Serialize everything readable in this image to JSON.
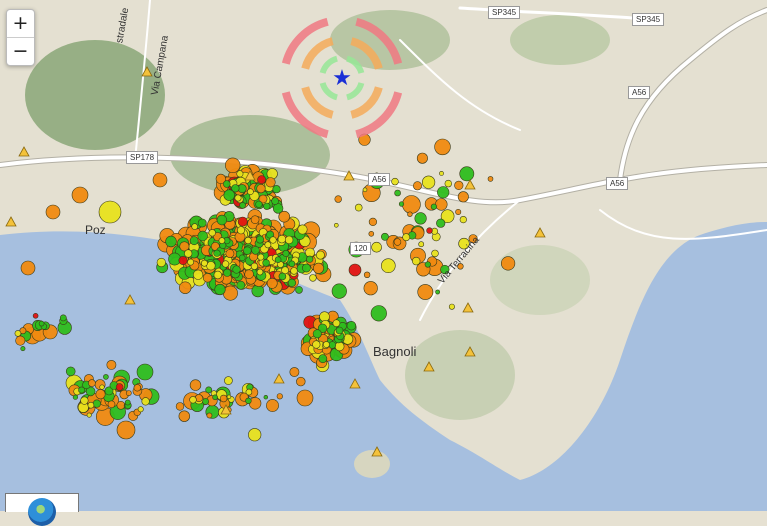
{
  "controls": {
    "zoom_in": "+",
    "zoom_out": "−"
  },
  "roads": [
    {
      "ref": "SP345"
    },
    {
      "ref": "SP345"
    },
    {
      "ref": "A56"
    },
    {
      "ref": "A56"
    },
    {
      "ref": "A56"
    },
    {
      "ref": "SP178"
    },
    {
      "ref": "120"
    }
  ],
  "places": {
    "bagnoli": "Bagnoli",
    "pozzuoli": "Poz",
    "via_campana": "Via Campana",
    "via_terracina": "Via Terracina",
    "strada": "stradale"
  },
  "legend": {
    "mag_colors": {
      "small": "#2ebd1e",
      "medium": "#e8e21e",
      "large": "#f08a10",
      "largest": "#e01212"
    }
  },
  "epicenter": {
    "marker": "blue-star",
    "color": "#1a2fd6"
  }
}
